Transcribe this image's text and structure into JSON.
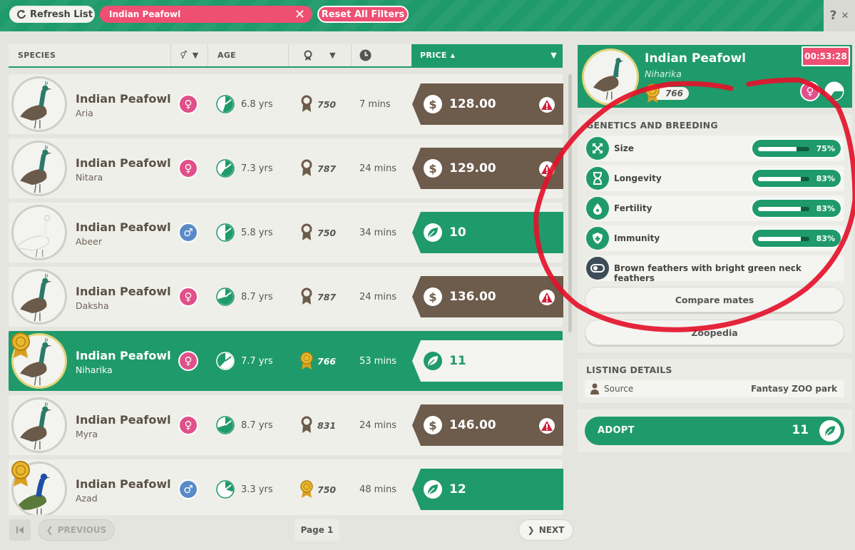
{
  "toolbar": {
    "refresh_label": "Refresh List",
    "search_tag": "Indian Peafowl",
    "reset_label": "Reset All Filters",
    "help_label": "?"
  },
  "list_header": {
    "species": "SPECIES",
    "age": "AGE",
    "price": "PRICE"
  },
  "rows": [
    {
      "name": "Indian Peafowl",
      "sub": "Aria",
      "sex": "female",
      "age": "6.8 yrs",
      "rank": "750",
      "time": "7 mins",
      "price": "128.00",
      "currency": "cash",
      "warning": true,
      "medal": false,
      "bird": "brown",
      "age_fill": 0.55
    },
    {
      "name": "Indian Peafowl",
      "sub": "Nitara",
      "sex": "female",
      "age": "7.3 yrs",
      "rank": "787",
      "time": "24 mins",
      "price": "129.00",
      "currency": "cash",
      "warning": true,
      "medal": false,
      "bird": "brown",
      "age_fill": 0.6
    },
    {
      "name": "Indian Peafowl",
      "sub": "Abeer",
      "sex": "male",
      "age": "5.8 yrs",
      "rank": "750",
      "time": "34 mins",
      "price": "10",
      "currency": "conservation",
      "warning": false,
      "medal": false,
      "bird": "white",
      "age_fill": 0.5
    },
    {
      "name": "Indian Peafowl",
      "sub": "Daksha",
      "sex": "female",
      "age": "8.7 yrs",
      "rank": "787",
      "time": "24 mins",
      "price": "136.00",
      "currency": "cash",
      "warning": true,
      "medal": false,
      "bird": "brown",
      "age_fill": 0.7
    },
    {
      "name": "Indian Peafowl",
      "sub": "Niharika",
      "sex": "female",
      "age": "7.7 yrs",
      "rank": "766",
      "time": "53 mins",
      "price": "11",
      "currency": "conservation",
      "warning": false,
      "medal": true,
      "selected": true,
      "bird": "brown",
      "age_fill": 0.62
    },
    {
      "name": "Indian Peafowl",
      "sub": "Myra",
      "sex": "female",
      "age": "8.7 yrs",
      "rank": "831",
      "time": "24 mins",
      "price": "146.00",
      "currency": "cash",
      "warning": true,
      "medal": false,
      "bird": "brown",
      "age_fill": 0.7
    },
    {
      "name": "Indian Peafowl",
      "sub": "Azad",
      "sex": "male",
      "age": "3.3 yrs",
      "rank": "750",
      "time": "48 mins",
      "price": "12",
      "currency": "conservation",
      "warning": false,
      "medal": true,
      "bird": "blue",
      "age_fill": 0.3
    }
  ],
  "pagination": {
    "prev_label": "PREVIOUS",
    "page_label": "Page 1",
    "next_label": "NEXT"
  },
  "detail": {
    "name": "Indian Peafowl",
    "sub": "Niharika",
    "rank": "766",
    "timer": "00:53:28",
    "sex": "female"
  },
  "genetics": {
    "title": "GENETICS AND BREEDING",
    "traits": [
      {
        "label": "Size",
        "pct": "75%",
        "value": 0.75,
        "icon": "size-icon"
      },
      {
        "label": "Longevity",
        "pct": "83%",
        "value": 0.83,
        "icon": "hourglass-icon"
      },
      {
        "label": "Fertility",
        "pct": "83%",
        "value": 0.83,
        "icon": "fertility-icon"
      },
      {
        "label": "Immunity",
        "pct": "83%",
        "value": 0.83,
        "icon": "immunity-shield-icon"
      }
    ],
    "feature": "Brown feathers with bright green neck feathers",
    "compare_label": "Compare mates",
    "zoopedia_label": "Zoopedia"
  },
  "listing": {
    "title": "LISTING DETAILS",
    "source_label": "Source",
    "source_value": "Fantasy ZOO park"
  },
  "adopt": {
    "label": "ADOPT",
    "value": "11"
  },
  "colors": {
    "green": "#1f9a6b",
    "pink": "#ef4f73",
    "brown": "#6d5b4b",
    "annotation_red": "#e3122b"
  }
}
